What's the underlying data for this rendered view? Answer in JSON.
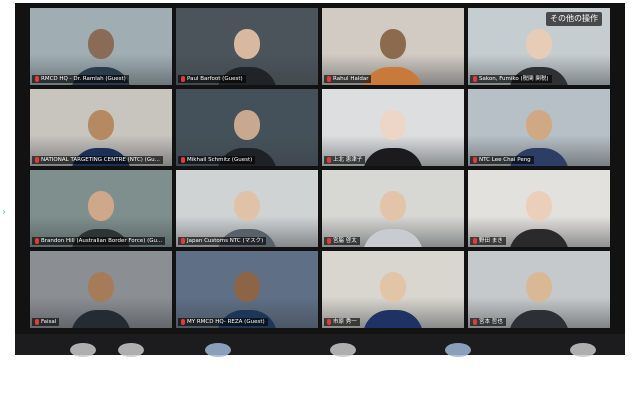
{
  "toolbar": {
    "more_label": "その他の操作"
  },
  "tiles": [
    {
      "name": "RMCD HQ - Dr. Ramlah (Guest)",
      "bg": "#a0aeb3",
      "skin": "#8a6b57",
      "shirt": "#2a3b4b"
    },
    {
      "name": "Paul Barfoot (Guest)",
      "bg": "#4a545a",
      "skin": "#d9b8a0",
      "shirt": "#202428"
    },
    {
      "name": "Rahul Haldar",
      "bg": "#d2cbc3",
      "skin": "#8c6a4e",
      "shirt": "#c97a3b"
    },
    {
      "name": "Sakon, Fumiko (税関 関税)",
      "bg": "#c6cdd1",
      "skin": "#e7cdb8",
      "shirt": "#2f3033"
    },
    {
      "name": "NATIONAL TARGETING CENTRE (NTC) (Gu...",
      "bg": "#c8c4be",
      "skin": "#b58a62",
      "shirt": "#1c2f57"
    },
    {
      "name": "Mikhail Schmitz (Guest)",
      "bg": "#45515a",
      "skin": "#c9a890",
      "shirt": "#1e2226"
    },
    {
      "name": "上北 恵津子",
      "bg": "#dcdedf",
      "skin": "#eed6c6",
      "shirt": "#1b1b1d"
    },
    {
      "name": "NTC Lee Chai Peng",
      "bg": "#b7c0c6",
      "skin": "#d0a884",
      "shirt": "#2c3d66"
    },
    {
      "name": "Brandon Hill (Australian Border Force) (Gu...",
      "bg": "#7e8f8d",
      "skin": "#cfa78a",
      "shirt": "#2d3436"
    },
    {
      "name": "Japan Customs NTC (マスク)",
      "bg": "#cfd3d4",
      "skin": "#e0c2a8",
      "shirt": "#58606a"
    },
    {
      "name": "宮脇 啓太",
      "bg": "#d7d7d4",
      "skin": "#e3c4ab",
      "shirt": "#c8ccd0"
    },
    {
      "name": "野田 まき",
      "bg": "#e3e1dd",
      "skin": "#eccfbb",
      "shirt": "#2a2a2c"
    },
    {
      "name": "Faisal",
      "bg": "#8b8f93",
      "skin": "#a67b5a",
      "shirt": "#242b33"
    },
    {
      "name": "MY RMCD HQ- REZA (Guest)",
      "bg": "#5f6f86",
      "skin": "#8c6546",
      "shirt": "#1d3557"
    },
    {
      "name": "市原 秀一",
      "bg": "#d9d6cf",
      "skin": "#e2c4a7",
      "shirt": "#1e3264"
    },
    {
      "name": "宮本 哲也",
      "bg": "#c5c9cb",
      "skin": "#d9b896",
      "shirt": "#2c2f33"
    }
  ]
}
